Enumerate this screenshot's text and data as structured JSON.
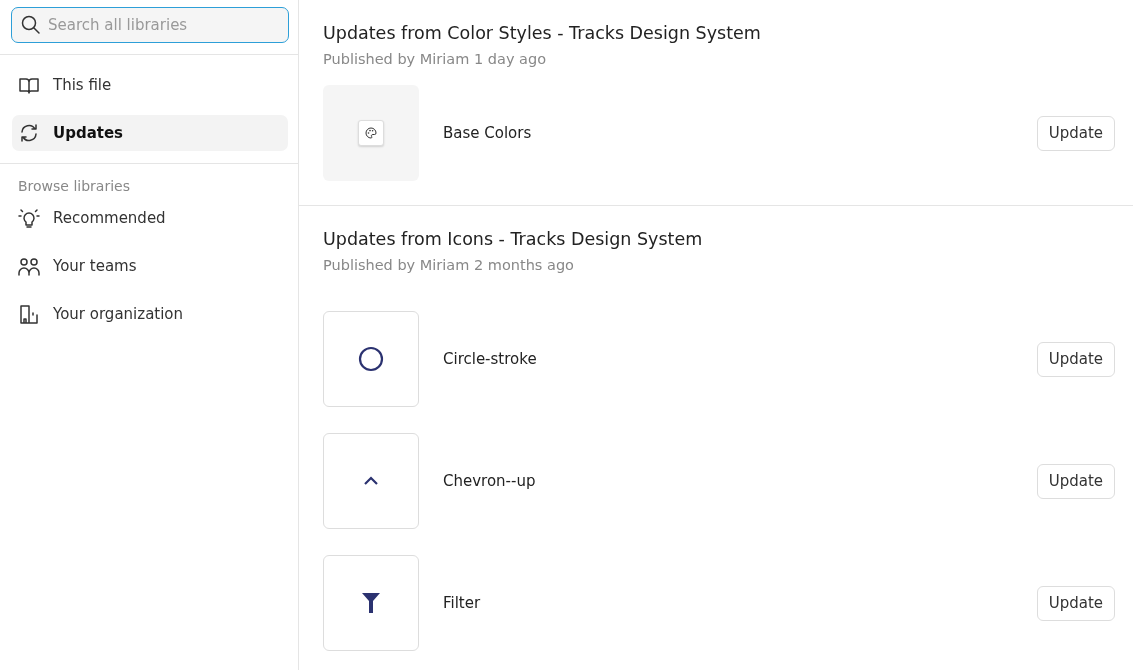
{
  "search": {
    "placeholder": "Search all libraries"
  },
  "nav": [
    {
      "label": "This file",
      "selected": false
    },
    {
      "label": "Updates",
      "selected": true
    }
  ],
  "browse": {
    "heading": "Browse libraries",
    "items": [
      {
        "label": "Recommended"
      },
      {
        "label": "Your teams"
      },
      {
        "label": "Your organization"
      }
    ]
  },
  "sections": [
    {
      "title": "Updates from Color Styles - Tracks Design System",
      "subtitle": "Published by Miriam 1 day ago",
      "items": [
        {
          "kind": "style",
          "name": "Base Colors",
          "button": "Update"
        }
      ]
    },
    {
      "title": "Updates from Icons - Tracks Design System",
      "subtitle": "Published by Miriam 2 months ago",
      "items": [
        {
          "kind": "component",
          "name": "Circle-stroke",
          "button": "Update"
        },
        {
          "kind": "component",
          "name": "Chevron--up",
          "button": "Update"
        },
        {
          "kind": "component",
          "name": "Filter",
          "button": "Update"
        }
      ]
    }
  ]
}
